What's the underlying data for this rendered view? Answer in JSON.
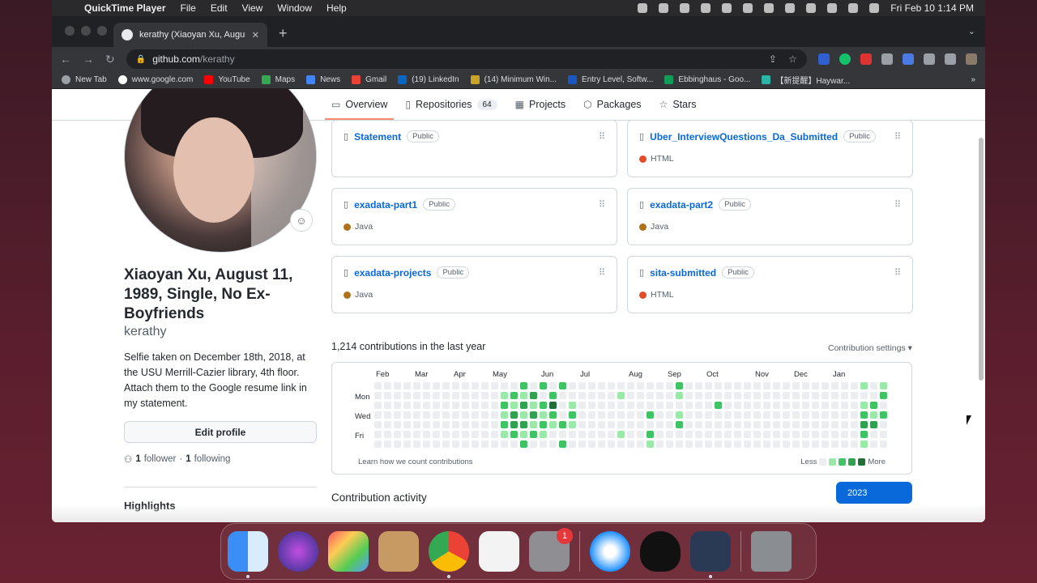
{
  "menubar": {
    "app": "QuickTime Player",
    "items": [
      "File",
      "Edit",
      "View",
      "Window",
      "Help"
    ],
    "clock": "Fri Feb 10  1:14 PM"
  },
  "browser": {
    "tab_title": "kerathy (Xiaoyan Xu, August 1",
    "url_host": "github.com",
    "url_path": "/kerathy",
    "bookmarks": [
      "New Tab",
      "www.google.com",
      "YouTube",
      "Maps",
      "News",
      "Gmail",
      "(19) LinkedIn",
      "(14) Minimum Win...",
      "Entry Level, Softw...",
      "Ebbinghaus - Goo...",
      "【新提醒】Haywar..."
    ]
  },
  "profile_nav": {
    "overview": "Overview",
    "repositories": "Repositories",
    "repo_count": "64",
    "projects": "Projects",
    "packages": "Packages",
    "stars": "Stars"
  },
  "profile": {
    "name": "Xiaoyan Xu, August 11, 1989, Single, No Ex-Boyfriends",
    "login": "kerathy",
    "bio": "Selfie taken on December 18th, 2018, at the USU Merrill-Cazier library, 4th floor. Attach them to the Google resume link in my statement.",
    "edit_label": "Edit profile",
    "followers": "1",
    "followers_label": "follower",
    "separator": "·",
    "following": "1",
    "following_label": "following",
    "highlights": "Highlights"
  },
  "pinned": [
    {
      "name": "Statement",
      "visibility": "Public",
      "language": "",
      "color": ""
    },
    {
      "name": "Uber_InterviewQuestions_Da_Submitted",
      "visibility": "Public",
      "language": "HTML",
      "color": "#e34c26"
    },
    {
      "name": "exadata-part1",
      "visibility": "Public",
      "language": "Java",
      "color": "#b07219"
    },
    {
      "name": "exadata-part2",
      "visibility": "Public",
      "language": "Java",
      "color": "#b07219"
    },
    {
      "name": "exadata-projects",
      "visibility": "Public",
      "language": "Java",
      "color": "#b07219"
    },
    {
      "name": "sita-submitted",
      "visibility": "Public",
      "language": "HTML",
      "color": "#e34c26"
    }
  ],
  "contributions": {
    "title": "1,214 contributions in the last year",
    "settings": "Contribution settings ▾",
    "months": [
      "Feb",
      "Mar",
      "Apr",
      "May",
      "Jun",
      "Jul",
      "Aug",
      "Sep",
      "Oct",
      "Nov",
      "Dec",
      "Jan"
    ],
    "days": [
      "Mon",
      "Wed",
      "Fri"
    ],
    "footer": "Learn how we count contributions",
    "less": "Less",
    "more": "More",
    "palette": [
      "#ebedf0",
      "#9be9a8",
      "#40c463",
      "#30a14e",
      "#216e39"
    ]
  },
  "activity": {
    "title": "Contribution activity",
    "year": "2023"
  },
  "dock": {
    "settings_badge": "1"
  }
}
